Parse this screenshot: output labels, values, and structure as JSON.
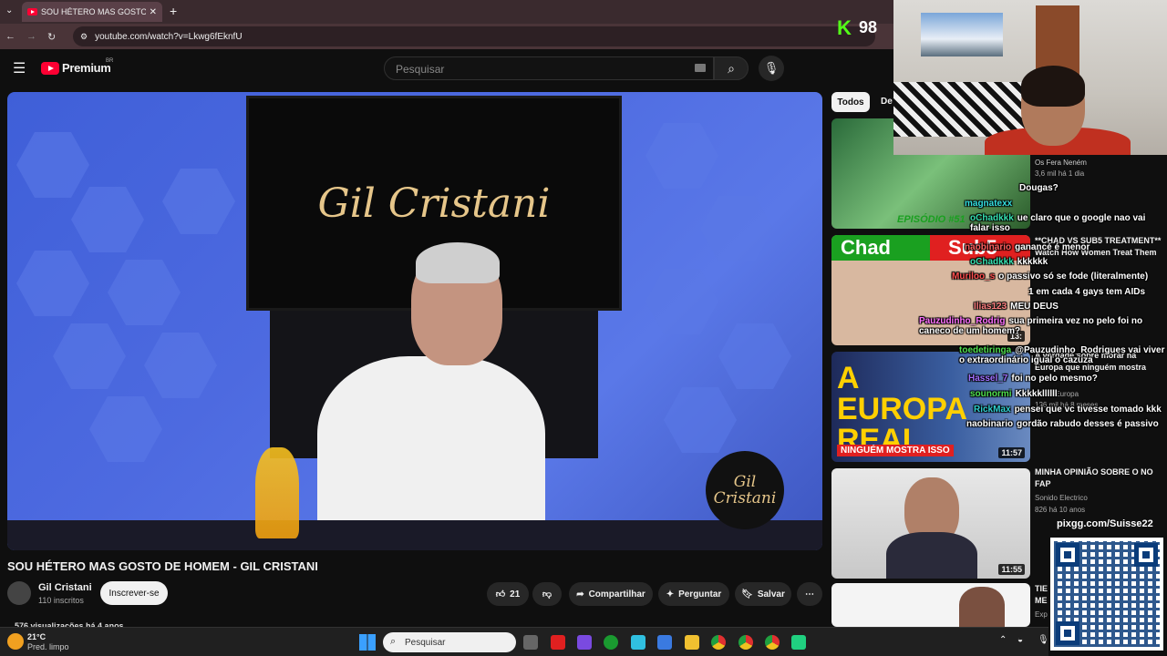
{
  "browser": {
    "tab_title": "SOU HÉTERO MAS GOSTO DE H",
    "url": "youtube.com/watch?v=Lkwg6fEknfU",
    "icons": [
      "back-icon",
      "forward-icon",
      "reload-icon",
      "tab-list-icon",
      "close-icon",
      "new-tab-icon"
    ]
  },
  "youtube": {
    "logo_text": "Premium",
    "logo_region": "BR",
    "search_placeholder": "Pesquisar",
    "video": {
      "tv_text": "Gil Cristani",
      "badge_text": "Gil\nCristani",
      "title": "SOU HÉTERO MAS GOSTO DE HOMEM - GIL CRISTANI",
      "channel": "Gil Cristani",
      "subscribers": "110 inscritos",
      "subscribe_label": "Inscrever-se",
      "likes": "21",
      "share_label": "Compartilhar",
      "ask_label": "Perguntar",
      "save_label": "Salvar",
      "views_line": "576 visualizações  há 4 anos"
    },
    "chips": {
      "all": "Todos",
      "more": "De"
    },
    "recommendations": [
      {
        "channel": "Os Fera Neném",
        "meta": "3,6 mil  há 1 dia",
        "thumb_text": "EPISÓDIO #51"
      },
      {
        "title": "**CHAD VS SUB5 TREATMENT** Watch How Women Treat Them",
        "thumb_text_left": "Chad",
        "thumb_text_right": "Sub5",
        "duration": "13:"
      },
      {
        "title": "A verdade sobre morar na Europa que ninguém mostra",
        "channel": "no na Europa",
        "meta": "126 mil  há 8 meses",
        "thumb_big": "A EUROPA REAL",
        "thumb_banner": "NINGUÉM MOSTRA ISSO",
        "duration": "11:57"
      },
      {
        "title": "MINHA OPINIÃO SOBRE O NO FAP",
        "channel": "Sonido Electrico",
        "meta": "826  há 10 anos",
        "duration": "11:55"
      },
      {
        "title": "TIE ME",
        "meta": "Exp"
      }
    ]
  },
  "stream": {
    "viewer_count": "98",
    "kick_letter": "K",
    "pix_url": "pixgg.com/Suisse22"
  },
  "chat": [
    {
      "user": "",
      "text": "Dougas?",
      "user_color": "#ffffff"
    },
    {
      "user": "magnatexx",
      "text": "",
      "user_color": "#35e0e0"
    },
    {
      "user": "oChadkkk",
      "text": "ue claro que o google nao vai falar isso",
      "user_color": "#35e0b0"
    },
    {
      "user": "naobinario",
      "text": "ganancé é menor",
      "user_color": "#ff6060"
    },
    {
      "user": "oChadkkk",
      "text": "kkkkkk",
      "user_color": "#35e0b0"
    },
    {
      "user": "Muriloo_s",
      "text": "o passivo só se fode (literalmente)",
      "user_color": "#ff5050"
    },
    {
      "user": "",
      "text": "1 em cada 4 gays tem AIDs",
      "user_color": "#ffffff"
    },
    {
      "user": "Ilias123",
      "text": "MEU DEUS",
      "user_color": "#ff8080"
    },
    {
      "user": "Pauzudinho_Rodrig",
      "text": "sua primeira vez no pelo foi no caneco de um homem?",
      "user_color": "#ff70ff"
    },
    {
      "user": "toedetiringa",
      "text": "@Pauzudinho_Rodrigues vai viver o extraordinário igual o cazuza",
      "user_color": "#50e050"
    },
    {
      "user": "Hassel_7",
      "text": "foi no pelo mesmo?",
      "user_color": "#a070ff"
    },
    {
      "user": "sounormi",
      "text": "Kkkkkllllll",
      "user_color": "#50e050"
    },
    {
      "user": "RickMax",
      "text": "pensei que vc tivesse tomado kkk",
      "user_color": "#30d0d0"
    },
    {
      "user": "naobinario",
      "text": "gordão rabudo desses é passivo",
      "user_color": "#ffffff"
    }
  ],
  "taskbar": {
    "temperature": "21°C",
    "weather": "Pred. limpo",
    "search_placeholder": "Pesquisar"
  },
  "colors": {
    "youtube_red": "#ff0033",
    "kick_green": "#53fc18"
  }
}
